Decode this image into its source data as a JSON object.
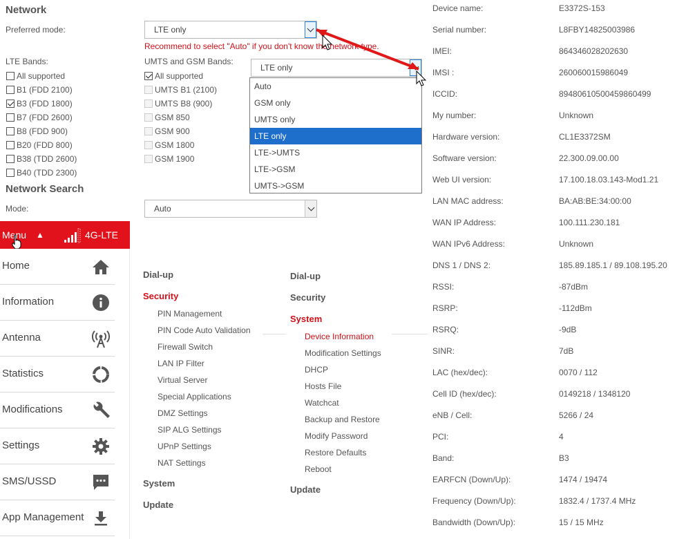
{
  "network": {
    "title": "Network",
    "preferred_mode_label": "Preferred mode:",
    "preferred_mode_value": "LTE only",
    "recommend_text": "Recommend to select \"Auto\" if you don't know the network type.",
    "lte_bands_label": "LTE Bands:",
    "lte_bands": [
      {
        "label": "All supported",
        "checked": false
      },
      {
        "label": "B1 (FDD 2100)",
        "checked": false
      },
      {
        "label": "B3 (FDD 1800)",
        "checked": true
      },
      {
        "label": "B7 (FDD 2600)",
        "checked": false
      },
      {
        "label": "B8 (FDD 900)",
        "checked": false
      },
      {
        "label": "B20 (FDD 800)",
        "checked": false
      },
      {
        "label": "B38 (TDD 2600)",
        "checked": false
      },
      {
        "label": "B40 (TDD 2300)",
        "checked": false
      }
    ],
    "umts_gsm_label": "UMTS and GSM Bands:",
    "umts_gsm_bands": [
      {
        "label": "All supported",
        "checked": true,
        "disabled": false
      },
      {
        "label": "UMTS B1 (2100)",
        "checked": false,
        "disabled": true
      },
      {
        "label": "UMTS B8 (900)",
        "checked": false,
        "disabled": true
      },
      {
        "label": "GSM 850",
        "checked": false,
        "disabled": true
      },
      {
        "label": "GSM 900",
        "checked": false,
        "disabled": true
      },
      {
        "label": "GSM 1800",
        "checked": false,
        "disabled": true
      },
      {
        "label": "GSM 1900",
        "checked": false,
        "disabled": true
      }
    ],
    "second_select_value": "LTE only",
    "dropdown_options": [
      "Auto",
      "GSM only",
      "UMTS only",
      "LTE only",
      "LTE->UMTS",
      "LTE->GSM",
      "UMTS->GSM"
    ],
    "dropdown_selected": "LTE only",
    "network_search_title": "Network Search",
    "mode_label": "Mode:",
    "mode_value": "Auto"
  },
  "menubar": {
    "menu_label": "Menu",
    "menu_arrow": "▲",
    "network_type": "4G-LTE"
  },
  "sidebar": {
    "items": [
      {
        "label": "Home",
        "icon": "home-icon"
      },
      {
        "label": "Information",
        "icon": "info-icon"
      },
      {
        "label": "Antenna",
        "icon": "antenna-icon"
      },
      {
        "label": "Statistics",
        "icon": "statistics-icon"
      },
      {
        "label": "Modifications",
        "icon": "wrench-icon"
      },
      {
        "label": "Settings",
        "icon": "gear-icon"
      },
      {
        "label": "SMS/USSD",
        "icon": "message-icon"
      },
      {
        "label": "App Management",
        "icon": "download-icon"
      }
    ]
  },
  "nav_left": {
    "dialup": "Dial-up",
    "security": "Security",
    "security_items": [
      "PIN Management",
      "PIN Code Auto Validation",
      "Firewall Switch",
      "LAN IP Filter",
      "Virtual Server",
      "Special Applications",
      "DMZ Settings",
      "SIP ALG Settings",
      "UPnP Settings",
      "NAT Settings"
    ],
    "system": "System",
    "update": "Update"
  },
  "nav_right": {
    "dialup": "Dial-up",
    "security": "Security",
    "system": "System",
    "system_items": [
      "Device Information",
      "Modification Settings",
      "DHCP",
      "Hosts File",
      "Watchcat",
      "Backup and Restore",
      "Modify Password",
      "Restore Defaults",
      "Reboot"
    ],
    "update": "Update"
  },
  "device_info": [
    {
      "label": "Device name:",
      "value": "E3372S-153"
    },
    {
      "label": "Serial number:",
      "value": "L8FBY14825003986"
    },
    {
      "label": "IMEI:",
      "value": "864346028202630"
    },
    {
      "label": "IMSI :",
      "value": "260060015986049"
    },
    {
      "label": "ICCID:",
      "value": "89480610500459860499"
    },
    {
      "label": "My number:",
      "value": "Unknown"
    },
    {
      "label": "Hardware version:",
      "value": "CL1E3372SM"
    },
    {
      "label": "Software version:",
      "value": "22.300.09.00.00"
    },
    {
      "label": "Web UI version:",
      "value": "17.100.18.03.143-Mod1.21"
    },
    {
      "label": "LAN MAC address:",
      "value": "BA:AB:BE:34:00:00"
    },
    {
      "label": "WAN IP Address:",
      "value": "100.111.230.181"
    },
    {
      "label": "WAN IPv6 Address:",
      "value": "Unknown"
    },
    {
      "label": "DNS 1 / DNS 2:",
      "value": "185.89.185.1 / 89.108.195.20"
    },
    {
      "label": "RSSI:",
      "value": "-87dBm"
    },
    {
      "label": "RSRP:",
      "value": "-112dBm"
    },
    {
      "label": "RSRQ:",
      "value": "-9dB"
    },
    {
      "label": "SINR:",
      "value": "7dB"
    },
    {
      "label": "LAC (hex/dec):",
      "value": "0070 / 112"
    },
    {
      "label": "Cell ID (hex/dec):",
      "value": "0149218 / 1348120"
    },
    {
      "label": "eNB / Cell:",
      "value": "5266 / 24"
    },
    {
      "label": "PCI:",
      "value": "4"
    },
    {
      "label": "Band:",
      "value": "B3"
    },
    {
      "label": "EARFCN (Down/Up):",
      "value": "1474 / 19474"
    },
    {
      "label": "Frequency (Down/Up):",
      "value": "1832.4 / 1737.4 MHz"
    },
    {
      "label": "Bandwidth (Down/Up):",
      "value": "15 / 15 MHz"
    }
  ],
  "colors": {
    "accent_red": "#e1121b",
    "selected_blue": "#1e6fcc",
    "annotation_red": "#e01818"
  }
}
